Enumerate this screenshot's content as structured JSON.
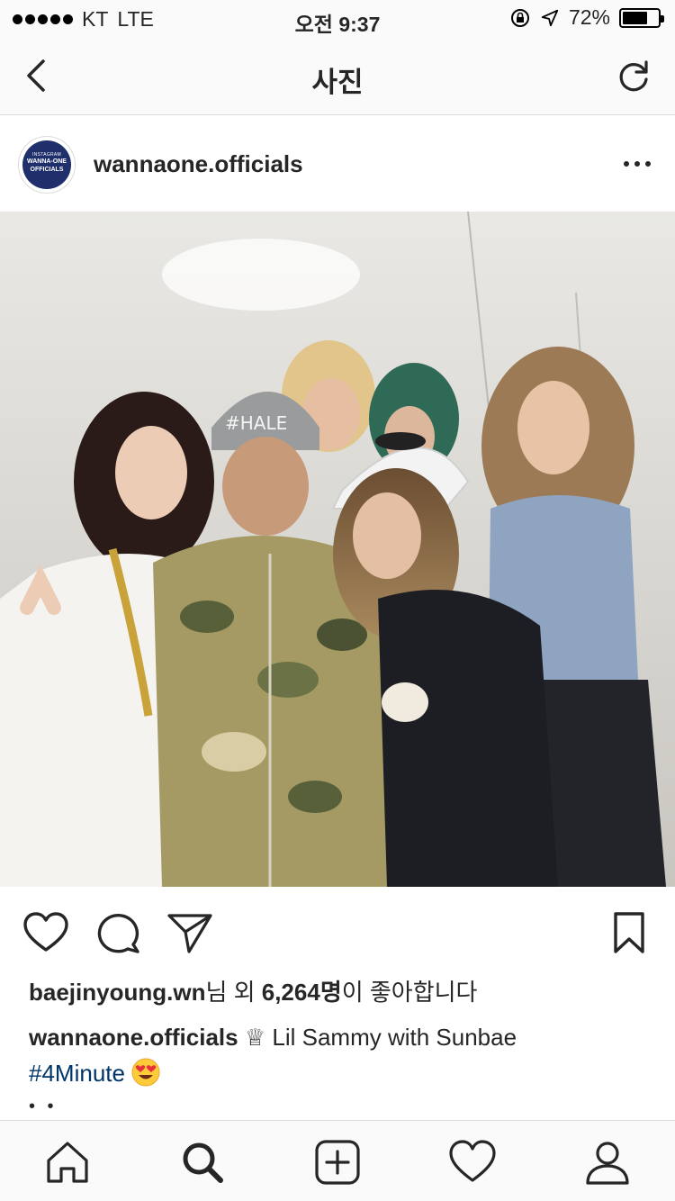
{
  "status_bar": {
    "carrier": "KT",
    "network": "LTE",
    "time": "오전 9:37",
    "battery_percent": "72%",
    "battery_level": 0.72
  },
  "nav": {
    "title": "사진"
  },
  "post": {
    "username": "wannaone.officials",
    "avatar_text": {
      "small": "INSTAGRAM",
      "line1": "WANNA-ONE",
      "line2": "OFFICIALS"
    },
    "likes": {
      "user": "baejinyoung.wn",
      "text_mid": "님 외 ",
      "count": "6,264명",
      "text_end": "이 좋아합니다"
    },
    "caption": {
      "username": "wannaone.officials",
      "crown": "♕",
      "text": " Lil Sammy with Sunbae",
      "hashtag": "#4Minute"
    },
    "more": "• •"
  },
  "icons": {
    "back": "chevron-left-icon",
    "refresh": "refresh-icon",
    "more": "more-horizontal-icon",
    "like": "heart-icon",
    "comment": "comment-icon",
    "share": "send-icon",
    "save": "bookmark-icon",
    "home": "home-icon",
    "search": "search-icon",
    "add": "add-post-icon",
    "activity": "activity-heart-icon",
    "profile": "profile-icon",
    "emoji": "heart-eyes-emoji"
  },
  "colors": {
    "hashtag": "#003569",
    "avatar_bg": "#1f2f6b",
    "divider": "#dbdbdb"
  }
}
